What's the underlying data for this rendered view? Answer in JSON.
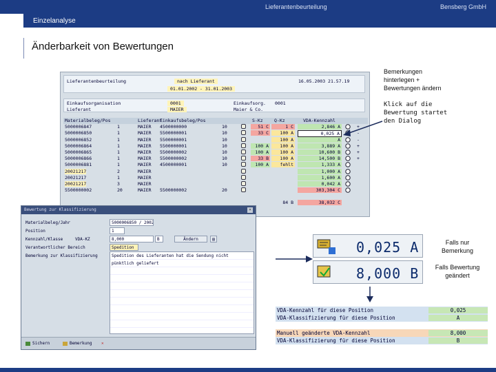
{
  "header": {
    "center_title": "Lieferantenbeurteilung",
    "company": "Bensberg GmbH",
    "section": "Einzelanalyse"
  },
  "page_title": "Änderbarkeit von Bewertungen",
  "sap": {
    "header": {
      "title": "Lieferantenbeurteilung",
      "mode": "nach Lieferant",
      "period": "01.01.2002 - 31.01.2003",
      "datetime": "16.05.2003 21.57.19"
    },
    "org": {
      "label1": "Einkaufsorganisation",
      "value1": "0001",
      "label2": "Lieferant",
      "value2": "MAIER",
      "label3": "Einkaufsorg.",
      "value3": "0001",
      "value4": "Maier & Co."
    },
    "columns": [
      "Materialbeleg/Pos",
      "Lieferant",
      "Einkaufsbeleg/Pos",
      "S-Kz",
      "Q-Kz",
      "VDA-Kennzahl"
    ],
    "rows": [
      {
        "mat": "5000006847",
        "pos": "1",
        "lief": "MAIER",
        "ek": "4500000000",
        "ekp": "10",
        "sk": "51 C",
        "skc": "red",
        "qk": "1 C",
        "qkc": "red",
        "vda": "2,846 A",
        "vdac": "green",
        "pm": "+"
      },
      {
        "mat": "5000006850",
        "pos": "1",
        "lief": "MAIER",
        "ek": "5500000001",
        "ekp": "10",
        "sk": "33 C",
        "skc": "red",
        "qk": "100 A",
        "qkc": "yellow",
        "vda": "0,025 A",
        "vdac": "sel",
        "pm": "-"
      },
      {
        "mat": "5000006852",
        "pos": "1",
        "lief": "MAIER",
        "ek": "5500000001",
        "ekp": "10",
        "sk": "",
        "skc": "",
        "qk": "100 A",
        "qkc": "yellow",
        "vda": "A",
        "vdac": "green",
        "pm": "-"
      },
      {
        "mat": "5000006864",
        "pos": "1",
        "lief": "MAIER",
        "ek": "5500000001",
        "ekp": "10",
        "sk": "100 A",
        "skc": "green",
        "qk": "100 A",
        "qkc": "yellow",
        "vda": "3,889 A",
        "vdac": "green",
        "pm": "+"
      },
      {
        "mat": "5000006865",
        "pos": "1",
        "lief": "MAIER",
        "ek": "5500000002",
        "ekp": "10",
        "sk": "100 A",
        "skc": "green",
        "qk": "100 A",
        "qkc": "yellow",
        "vda": "10,600 B",
        "vdac": "green",
        "pm": "+"
      },
      {
        "mat": "5000006866",
        "pos": "1",
        "lief": "MAIER",
        "ek": "5500000002",
        "ekp": "10",
        "sk": "33 B",
        "skc": "red",
        "qk": "100 A",
        "qkc": "yellow",
        "vda": "14,500 B",
        "vdac": "green",
        "pm": "+"
      },
      {
        "mat": "5000006881",
        "pos": "1",
        "lief": "MAIER",
        "ek": "4500000001",
        "ekp": "10",
        "sk": "100 A",
        "skc": "green",
        "qk": "fehlt",
        "qkc": "yellow",
        "vda": "1,333 A",
        "vdac": "green",
        "pm": ""
      },
      {
        "mat": "20021217",
        "pos": "2",
        "lief": "MAIER",
        "ek": "",
        "ekp": "",
        "sk": "",
        "skc": "",
        "qk": "",
        "qkc": "",
        "vda": "1,000 A",
        "vdac": "green",
        "pm": "",
        "hl": true
      },
      {
        "mat": "20021217",
        "pos": "1",
        "lief": "MAIER",
        "ek": "",
        "ekp": "",
        "sk": "",
        "skc": "",
        "qk": "",
        "qkc": "",
        "vda": "1,600 A",
        "vdac": "green",
        "pm": ""
      },
      {
        "mat": "20021217",
        "pos": "3",
        "lief": "MAIER",
        "ek": "",
        "ekp": "",
        "sk": "",
        "skc": "",
        "qk": "",
        "qkc": "",
        "vda": "0,042 A",
        "vdac": "green",
        "pm": "",
        "hl": true
      },
      {
        "mat": "5500000002",
        "pos": "20",
        "lief": "MAIER",
        "ek": "5500000002",
        "ekp": "20",
        "sk": "",
        "skc": "",
        "qk": "",
        "qkc": "",
        "vda": "303,304 C",
        "vdac": "red",
        "pm": ""
      },
      {
        "mat": "",
        "pos": "",
        "lief": "",
        "ek": "",
        "ekp": "",
        "sk": "",
        "skc": "",
        "qk": "",
        "qkc": "",
        "vda": "",
        "vdac": "",
        "pm": ""
      },
      {
        "mat": "",
        "pos": "",
        "lief": "",
        "ek": "",
        "ekp": "",
        "sk": "",
        "skc": "",
        "qk": "84 B",
        "qkc": "",
        "vda": "38,032 C",
        "vdac": "red",
        "pm": ""
      }
    ]
  },
  "dialog": {
    "title": "Bewertung zur Klassifizierung",
    "labels": [
      "Materialbeleg/Jahr",
      "Position",
      "Kennzahl/Klasse",
      "Verantwortlicher Bereich",
      "Bemerkung zur Klassifizierung"
    ],
    "matbeleg": "5000006850 / 2002",
    "position": "1",
    "kennzahl_label": "VDA-KZ",
    "kennzahl": "8,000",
    "klasse": "B",
    "btn_aendern": "Ändern",
    "bereich": "Spedition",
    "remarks": [
      "Spedition des Lieferanten hat die Sendung nicht",
      "pünktlich geliefert"
    ],
    "footer": {
      "ok": "Sichern",
      "note": "Bemerkung"
    }
  },
  "notes": {
    "n1": [
      "Bemerkungen",
      "hinterlegen +",
      "Bewertungen ändern"
    ],
    "n2": [
      "Klick auf die",
      "Bewertung startet",
      "den Dialog"
    ],
    "n3": [
      "Falls nur",
      "Bemerkung"
    ],
    "n4": [
      "Falls Bewertung",
      "geändert"
    ]
  },
  "big": {
    "v1": "0,025 A",
    "v2": "8,000 B"
  },
  "bottom_table": [
    {
      "label": "VDA-Kennzahl für diese Position",
      "value": "0,025",
      "cls": "blue"
    },
    {
      "label": "VDA-Klassifizierung für diese Position",
      "value": "A",
      "cls": "blue"
    },
    {
      "label": "",
      "value": "",
      "cls": ""
    },
    {
      "label": "Manuell geänderte VDA-Kennzahl",
      "value": "8,000",
      "cls": "orange"
    },
    {
      "label": "VDA-Klassifizierung für diese Position",
      "value": "B",
      "cls": "blue"
    }
  ]
}
